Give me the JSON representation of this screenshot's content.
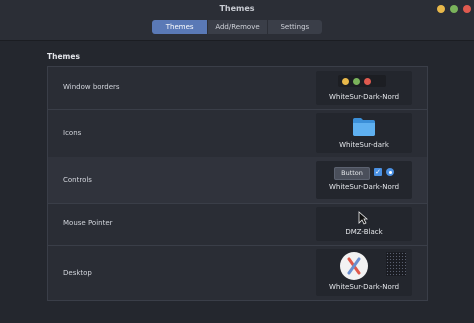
{
  "window": {
    "title": "Themes"
  },
  "tabs": [
    {
      "label": "Themes",
      "active": true
    },
    {
      "label": "Add/Remove",
      "active": false
    },
    {
      "label": "Settings",
      "active": false
    }
  ],
  "section": {
    "title": "Themes"
  },
  "rows": [
    {
      "label": "Window borders",
      "theme": "WhiteSur-Dark-Nord"
    },
    {
      "label": "Icons",
      "theme": "WhiteSur-dark"
    },
    {
      "label": "Controls",
      "theme": "WhiteSur-Dark-Nord",
      "button_label": "Button"
    },
    {
      "label": "Mouse Pointer",
      "theme": "DMZ-Black"
    },
    {
      "label": "Desktop",
      "theme": "WhiteSur-Dark-Nord"
    }
  ],
  "colors": {
    "accent": "#5a79b6",
    "window_minimize": "#e8b84a",
    "window_maximize": "#7ab35b",
    "window_close": "#e05a4f"
  }
}
